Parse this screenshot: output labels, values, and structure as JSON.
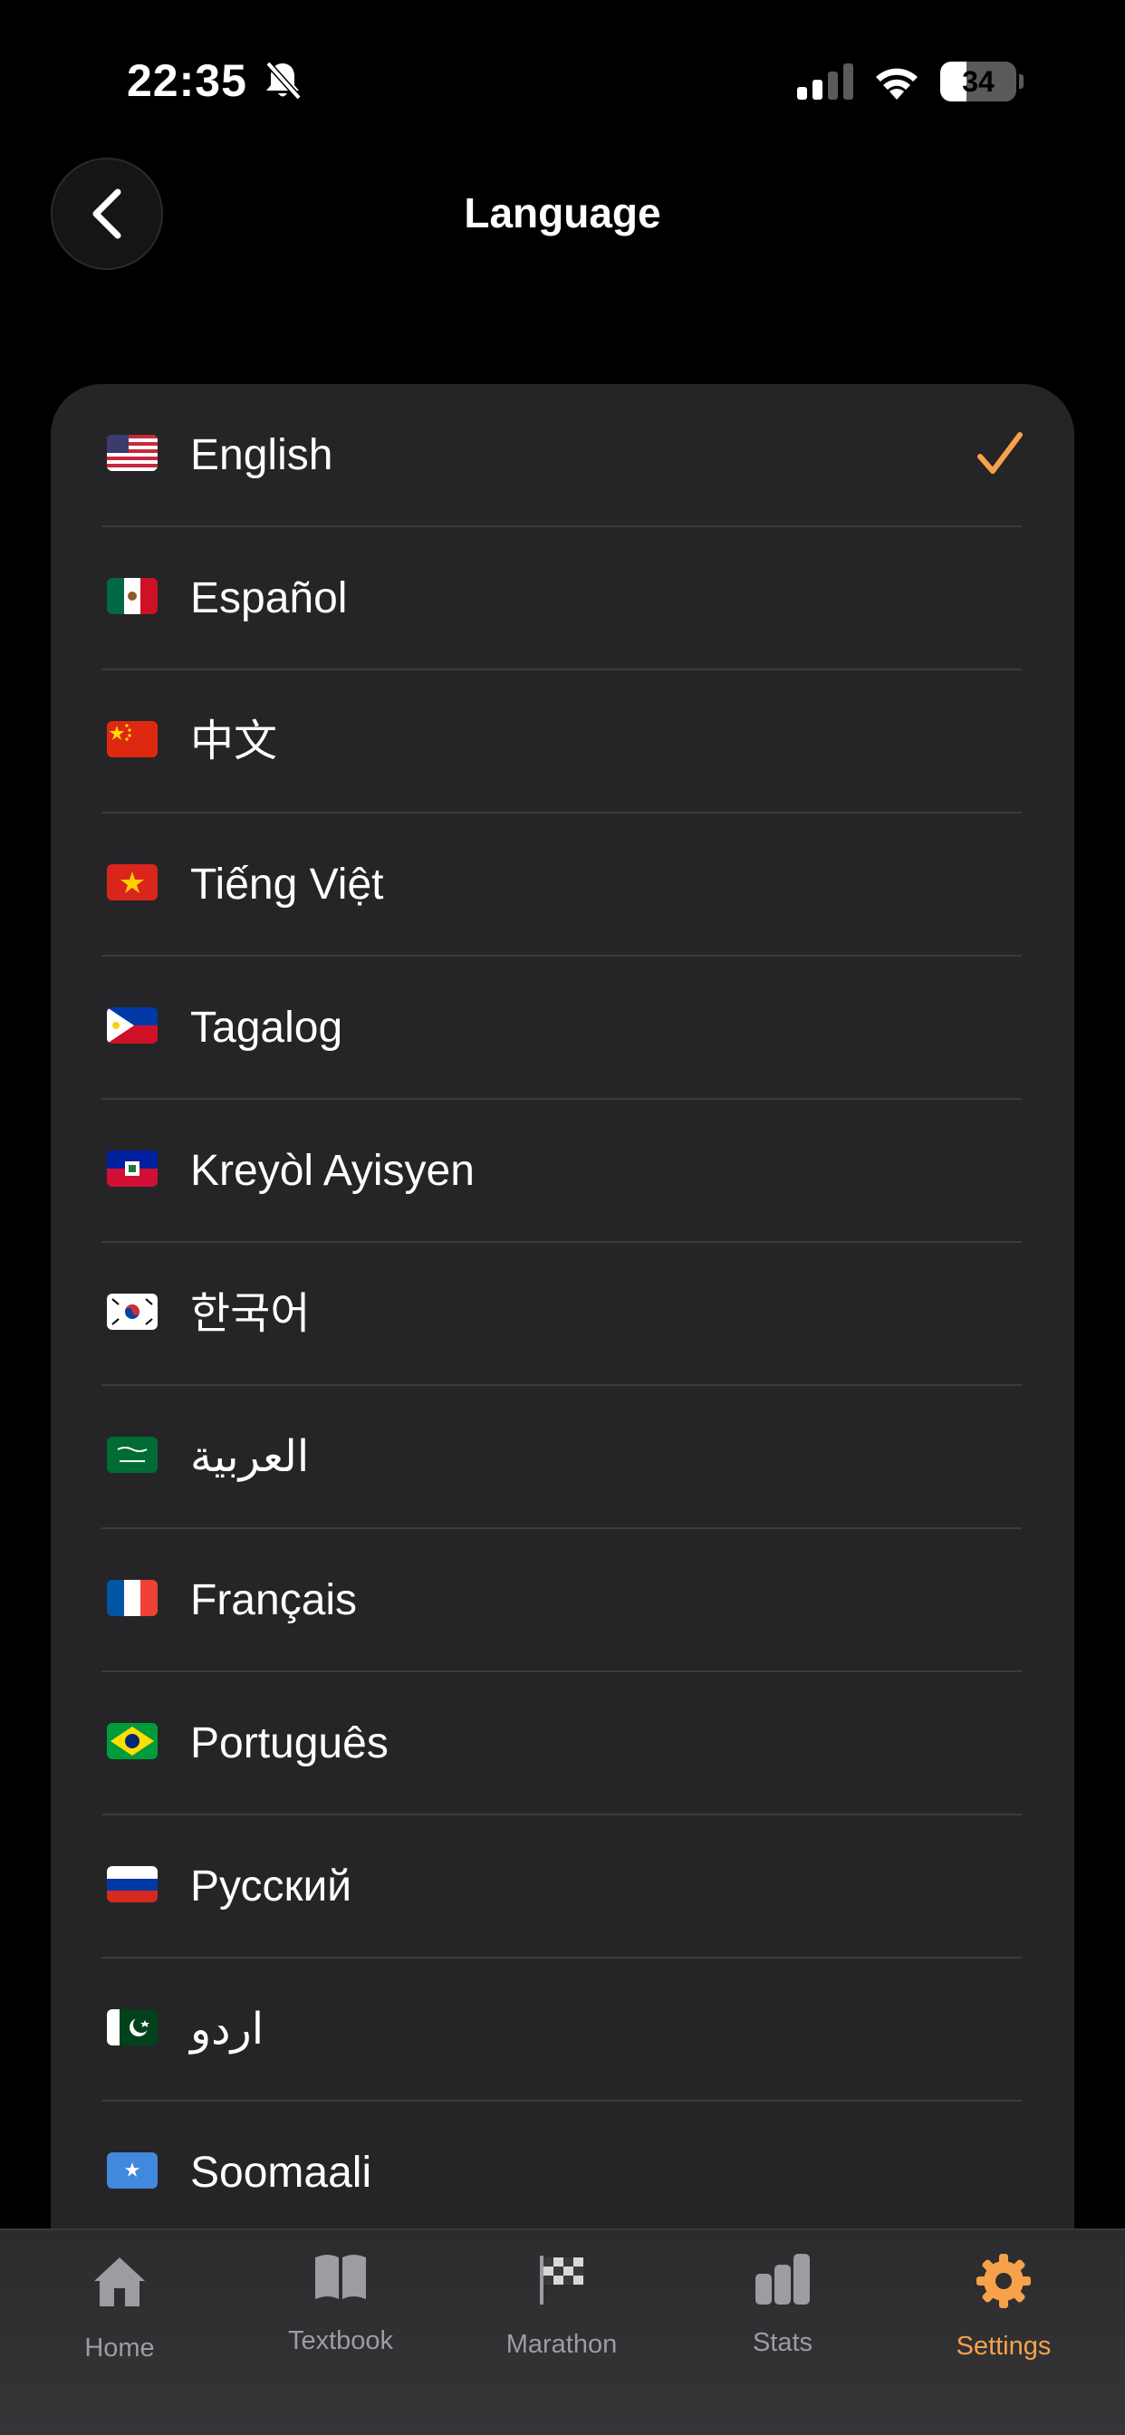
{
  "status_bar": {
    "time": "22:35",
    "battery_percent": 34,
    "battery_text": "34",
    "icons": [
      "bell-slash-icon",
      "cellular-signal-icon",
      "wifi-icon",
      "battery-icon"
    ]
  },
  "nav": {
    "title": "Language",
    "back_icon": "chevron-left-icon"
  },
  "languages": [
    {
      "label": "English",
      "flag": "us-flag",
      "selected": true
    },
    {
      "label": "Español",
      "flag": "mexico-flag",
      "selected": false
    },
    {
      "label": "中文",
      "flag": "china-flag",
      "selected": false
    },
    {
      "label": "Tiếng Việt",
      "flag": "vietnam-flag",
      "selected": false
    },
    {
      "label": "Tagalog",
      "flag": "philippines-flag",
      "selected": false
    },
    {
      "label": "Kreyòl Ayisyen",
      "flag": "haiti-flag",
      "selected": false
    },
    {
      "label": "한국어",
      "flag": "south-korea-flag",
      "selected": false
    },
    {
      "label": "العربية",
      "flag": "saudi-arabia-flag",
      "selected": false
    },
    {
      "label": "Français",
      "flag": "france-flag",
      "selected": false
    },
    {
      "label": "Português",
      "flag": "brazil-flag",
      "selected": false
    },
    {
      "label": "Русский",
      "flag": "russia-flag",
      "selected": false
    },
    {
      "label": "اردو",
      "flag": "pakistan-flag",
      "selected": false
    },
    {
      "label": "Soomaali",
      "flag": "somalia-flag",
      "selected": false
    }
  ],
  "tab_bar": {
    "tabs": [
      {
        "label": "Home",
        "icon": "house-icon",
        "active": false
      },
      {
        "label": "Textbook",
        "icon": "book-icon",
        "active": false
      },
      {
        "label": "Marathon",
        "icon": "checkered-flag-icon",
        "active": false
      },
      {
        "label": "Stats",
        "icon": "bar-chart-icon",
        "active": false
      },
      {
        "label": "Settings",
        "icon": "gear-icon",
        "active": true
      }
    ]
  },
  "colors": {
    "accent": "#f7a24b",
    "background": "#000000",
    "card": "#252527",
    "inactive": "#9c9ca1"
  }
}
